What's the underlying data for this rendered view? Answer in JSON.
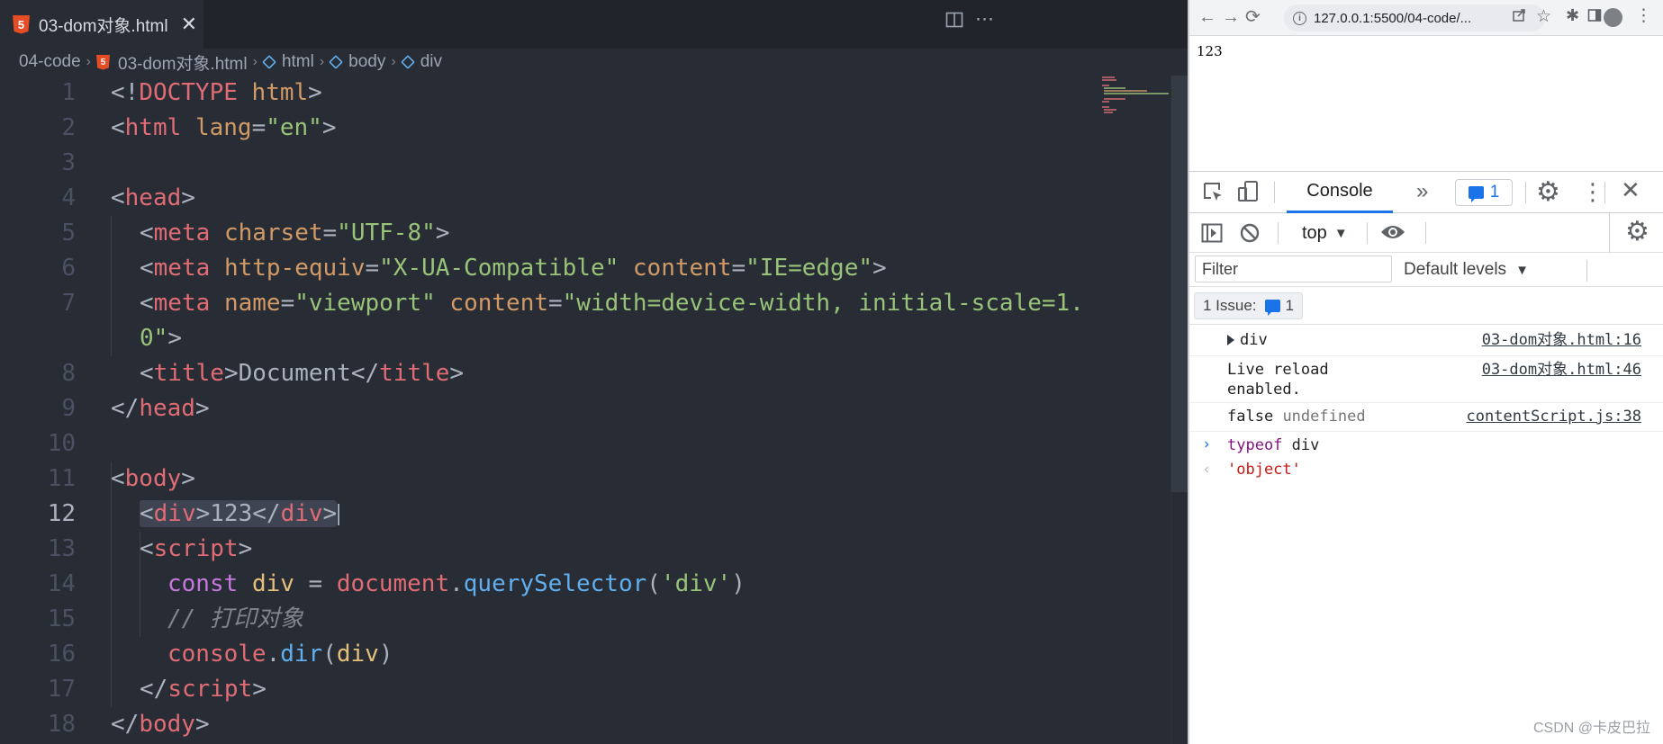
{
  "editor": {
    "tab": {
      "label": "03-dom对象.html",
      "icon": "html5-icon",
      "close": "✕"
    },
    "actions": {
      "split": "split-editor-icon",
      "more": "⋯"
    },
    "breadcrumb": [
      "04-code",
      "03-dom对象.html",
      "html",
      "body",
      "div"
    ],
    "active_line": 12,
    "line_numbers": [
      "1",
      "2",
      "3",
      "4",
      "5",
      "6",
      "7",
      "",
      "8",
      "9",
      "10",
      "11",
      "12",
      "13",
      "14",
      "15",
      "16",
      "17",
      "18"
    ],
    "code": {
      "l1": [
        "<!",
        "DOCTYPE",
        " ",
        "html",
        ">"
      ],
      "l2": [
        "<",
        "html",
        " ",
        "lang",
        "=",
        "\"en\"",
        ">"
      ],
      "l4": [
        "<",
        "head",
        ">"
      ],
      "l5": [
        "<",
        "meta",
        " ",
        "charset",
        "=",
        "\"UTF-8\"",
        ">"
      ],
      "l6": [
        "<",
        "meta",
        " ",
        "http-equiv",
        "=",
        "\"X-UA-Compatible\"",
        " ",
        "content",
        "=",
        "\"IE=edge\"",
        ">"
      ],
      "l7a": [
        "<",
        "meta",
        " ",
        "name",
        "=",
        "\"viewport\"",
        " ",
        "content",
        "=",
        "\"width=device-width, initial-scale=1."
      ],
      "l7b": [
        "0\"",
        ">"
      ],
      "l8": [
        "<",
        "title",
        ">",
        "Document",
        "</",
        "title",
        ">"
      ],
      "l9": [
        "</",
        "head",
        ">"
      ],
      "l11": [
        "<",
        "body",
        ">"
      ],
      "l12": [
        "<",
        "div",
        ">",
        "123",
        "</",
        "div",
        ">"
      ],
      "l13": [
        "<",
        "script",
        ">"
      ],
      "l14": [
        "const",
        " ",
        "div",
        " = ",
        "document",
        ".",
        "querySelector",
        "(",
        "'div'",
        ")"
      ],
      "l15": [
        "// 打印对象"
      ],
      "l16": [
        "console",
        ".",
        "dir",
        "(",
        "div",
        ")"
      ],
      "l17": [
        "</",
        "script",
        ">"
      ],
      "l18": [
        "</",
        "body",
        ">"
      ]
    }
  },
  "browser": {
    "url": "127.0.0.1:5500/04-code/...",
    "page_content": "123",
    "nav": {
      "back": "←",
      "forward": "→",
      "reload": "⟳"
    },
    "toolbar_icons": [
      "share-icon",
      "star-icon",
      "extensions-icon",
      "side-panel-icon",
      "profile-avatar",
      "menu-icon"
    ]
  },
  "devtools": {
    "tab_console": "Console",
    "more_tabs": "»",
    "messages_count": "1",
    "context": "top",
    "filter_placeholder": "Filter",
    "levels": "Default levels",
    "issues_label": "1 Issue:",
    "issues_count": "1",
    "logs": [
      {
        "text": "div",
        "source": "03-dom对象.html:16"
      },
      {
        "text": "Live reload\nenabled.",
        "source": "03-dom对象.html:46"
      },
      {
        "text_a": "false",
        "text_b": "undefined",
        "source": "contentScript.js:38"
      }
    ],
    "input": {
      "keyword": "typeof",
      "rest": " div"
    },
    "result": "'object'"
  },
  "watermark": "CSDN @卡皮巴拉",
  "colors": {
    "editor_bg": "#282c34",
    "tag": "#e06c75",
    "attr": "#d19a66",
    "string": "#98c379",
    "keyword": "#c678dd",
    "variable": "#e5c07b",
    "function": "#61afef",
    "comment": "#7f848e",
    "devtools_accent": "#1a73e8"
  }
}
